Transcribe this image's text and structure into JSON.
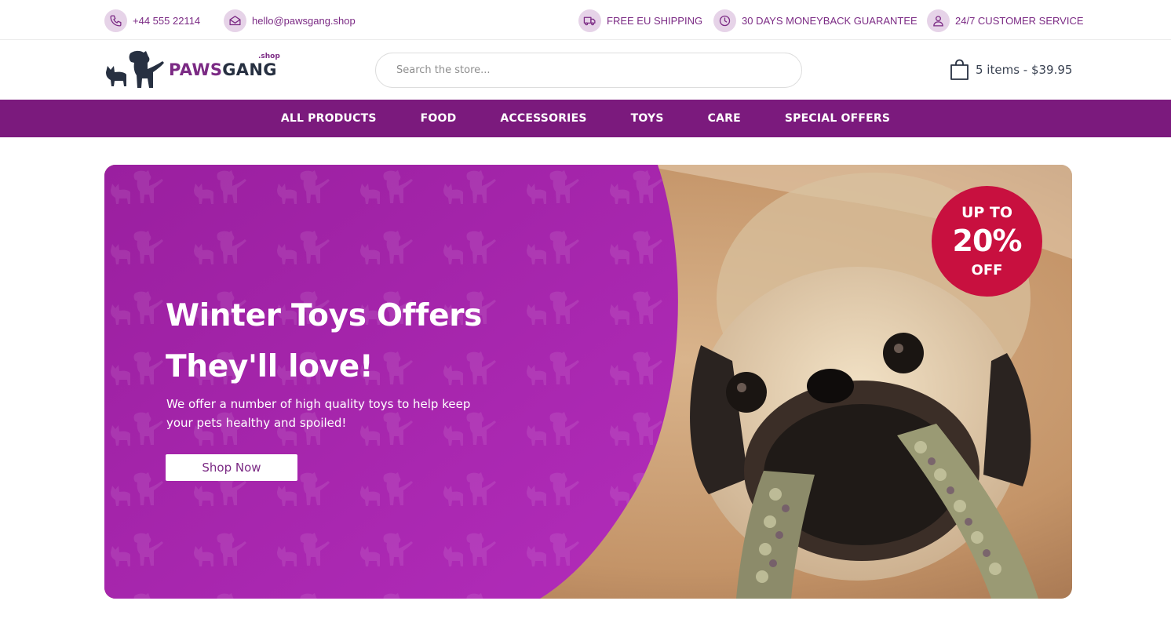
{
  "topbar": {
    "phone": "+44 555 22114",
    "email": "hello@pawsgang.shop",
    "shipping": "FREE EU SHIPPING",
    "guarantee": "30 DAYS MONEYBACK GUARANTEE",
    "service": "24/7 CUSTOMER SERVICE"
  },
  "header": {
    "logo": {
      "paws": "PAWS",
      "gang": "GANG",
      "suffix": ".shop"
    },
    "search_placeholder": "Search the store...",
    "cart_label": "5 items - $39.95"
  },
  "nav": {
    "items": [
      {
        "label": "ALL PRODUCTS"
      },
      {
        "label": "FOOD"
      },
      {
        "label": "ACCESSORIES"
      },
      {
        "label": "TOYS"
      },
      {
        "label": "CARE"
      },
      {
        "label": "SPECIAL OFFERS"
      }
    ]
  },
  "hero": {
    "title_line1": "Winter Toys Offers",
    "title_line2": "They'll love!",
    "subtitle": "We offer a number of high quality toys to help keep your pets healthy and spoiled!",
    "button": "Shop Now",
    "badge": {
      "line1": "UP TO",
      "line2": "20%",
      "line3": "OFF"
    }
  },
  "icons": {
    "phone": "phone-icon",
    "email": "envelope-icon",
    "shipping": "truck-icon",
    "guarantee": "clock-icon",
    "service": "user-icon",
    "cart": "shopping-bag-icon",
    "logo": "dogs-logo-icon"
  },
  "colors": {
    "brand_purple": "#7b1a7d",
    "hero_purple": "#a321a8",
    "badge_red": "#c8103f",
    "icon_bg": "#e6d3e8",
    "logo_dark": "#273041"
  }
}
